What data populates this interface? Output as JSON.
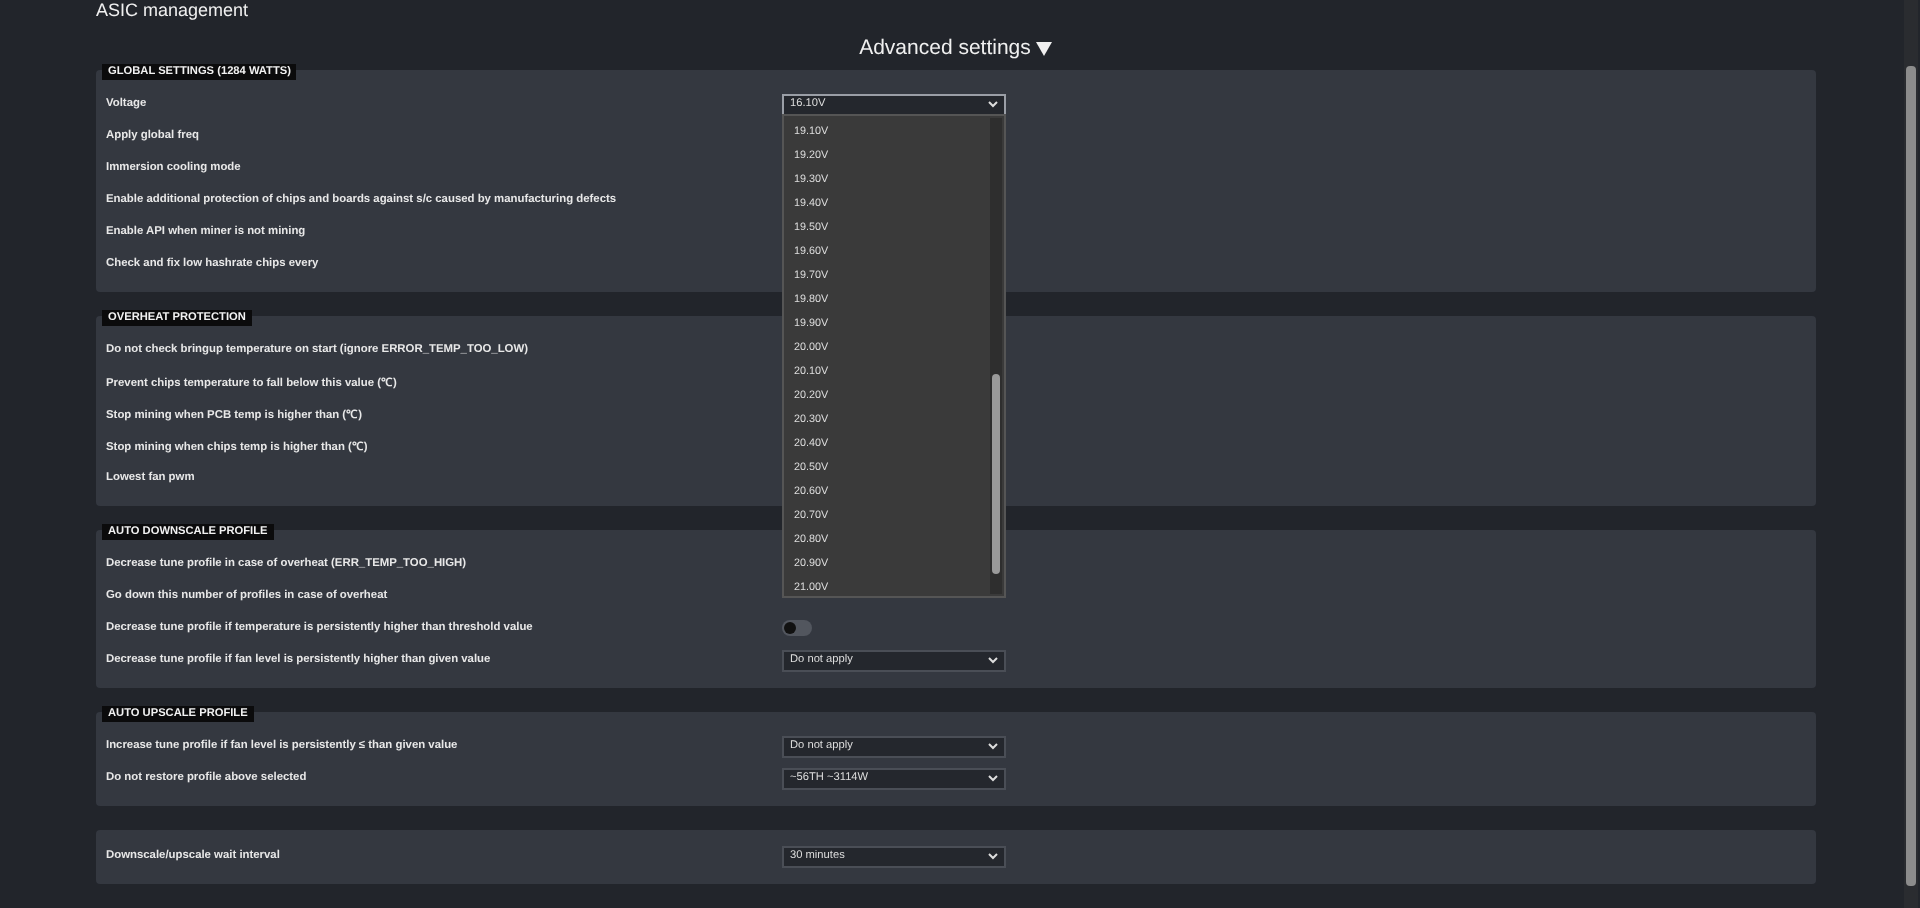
{
  "page_title": "ASIC management",
  "advanced_toggle": {
    "label": "Advanced settings",
    "expanded": true
  },
  "sections": [
    {
      "title": "GLOBAL SETTINGS (1284 WATTS)",
      "rows": [
        {
          "label": "Voltage",
          "kind": "dropdown",
          "value": "16.10V",
          "open": true
        },
        {
          "label": "Apply global freq",
          "kind": "covered"
        },
        {
          "label": "Immersion cooling mode",
          "kind": "covered"
        },
        {
          "label": "Enable additional protection of chips and boards against s/c caused by manufacturing defects",
          "kind": "covered"
        },
        {
          "label": "Enable API when miner is not mining",
          "kind": "covered"
        },
        {
          "label": "Check and fix low hashrate chips every",
          "kind": "covered"
        }
      ]
    },
    {
      "title": "OVERHEAT PROTECTION",
      "rows": [
        {
          "label": "Do not check bringup temperature on start (ignore ERROR_TEMP_TOO_LOW)",
          "kind": "covered"
        },
        {
          "label": "Prevent chips temperature to fall below this value (℃)",
          "kind": "covered"
        },
        {
          "label": "Stop mining when PCB temp is higher than (℃)",
          "kind": "covered"
        },
        {
          "label": "Stop mining when chips temp is higher than (℃)",
          "kind": "covered"
        },
        {
          "label": "Lowest **fan** pwm",
          "kind": "covered"
        }
      ]
    },
    {
      "title": "AUTO DOWNSCALE PROFILE",
      "rows": [
        {
          "label": "Decrease tune profile in case of overheat (ERR_TEMP_TOO_HIGH)",
          "kind": "covered"
        },
        {
          "label": "Go down this number of profiles in case of overheat",
          "kind": "covered"
        },
        {
          "label": "Decrease tune profile if temperature is persistently higher than threshold value",
          "kind": "toggle",
          "on": false
        },
        {
          "label": "Decrease tune profile if **fan** level is persistently higher than given value",
          "kind": "dropdown",
          "value": "Do not apply",
          "open": false
        }
      ]
    },
    {
      "title": "AUTO UPSCALE PROFILE",
      "rows": [
        {
          "label": "Increase tune profile if **fan** level is persistently ≤ than given value",
          "kind": "dropdown",
          "value": "Do not apply",
          "open": false
        },
        {
          "label": "Do not restore profile above selected",
          "kind": "dropdown",
          "value": "~56TH ~3114W",
          "open": false
        }
      ]
    },
    {
      "rows": [
        {
          "label": "Downscale/upscale wait interval",
          "kind": "dropdown",
          "value": "30 minutes",
          "open": false
        }
      ]
    }
  ],
  "voltage_options": [
    "19.10V",
    "19.20V",
    "19.30V",
    "19.40V",
    "19.50V",
    "19.60V",
    "19.70V",
    "19.80V",
    "19.90V",
    "20.00V",
    "20.10V",
    "20.20V",
    "20.30V",
    "20.40V",
    "20.50V",
    "20.60V",
    "20.70V",
    "20.80V",
    "20.90V",
    "21.00V"
  ]
}
